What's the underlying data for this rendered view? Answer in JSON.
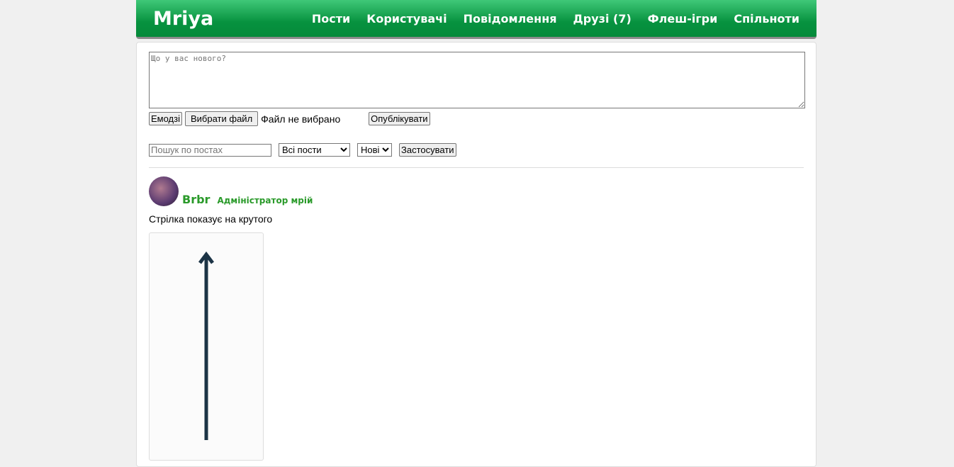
{
  "header": {
    "logo": "Mriya",
    "nav": [
      "Пости",
      "Користувачі",
      "Повідомлення",
      "Друзі (7)",
      "Флеш-ігри",
      "Спільноти"
    ]
  },
  "composer": {
    "placeholder": "Що у вас нового?",
    "emoji": "Емодзі",
    "choose_file": "Вибрати файл",
    "no_file": "Файл не вибрано",
    "publish": "Опублікувати"
  },
  "filters": {
    "search_placeholder": "Пошук по постах",
    "type": "Всі пости",
    "sort": "Нові",
    "apply": "Застосувати"
  },
  "post": {
    "author": "Brbr",
    "role": "Адміністратор мрій",
    "text": "Стрілка показує на крутого"
  }
}
